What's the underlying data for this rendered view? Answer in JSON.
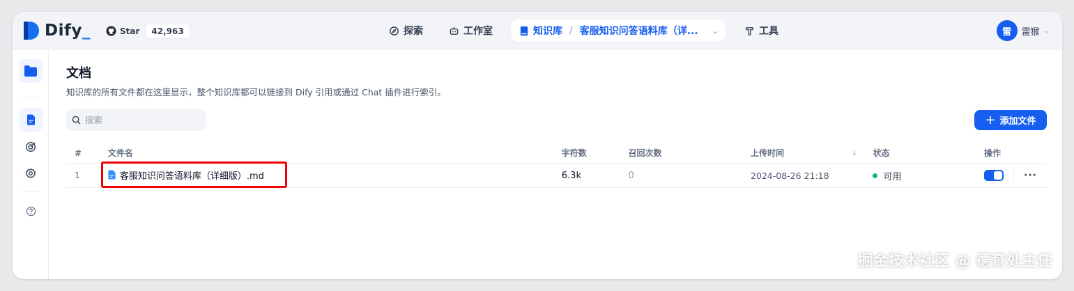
{
  "header": {
    "logo_text": "Dify",
    "logo_cursor": "_",
    "github": {
      "star_label": "Star",
      "star_count": "42,963"
    },
    "nav": {
      "explore": "探索",
      "studio": "工作室",
      "dataset": "知识库",
      "dataset_separator": "/",
      "dataset_current": "客服知识问答语料库（详...",
      "tools": "工具"
    },
    "user": {
      "avatar_initial": "雷",
      "name": "雷猴"
    }
  },
  "main": {
    "title": "文档",
    "description": "知识库的所有文件都在这里显示，整个知识库都可以链接到 Dify 引用或通过 Chat 插件进行索引。",
    "search_placeholder": "搜索",
    "add_button": "添加文件",
    "table": {
      "headers": {
        "index": "#",
        "name": "文件名",
        "chars": "字符数",
        "hits": "召回次数",
        "upload_time": "上传时间",
        "status": "状态",
        "actions": "操作"
      },
      "rows": [
        {
          "index": "1",
          "name": "客服知识问答语料库（详细版）.md",
          "chars": "6.3k",
          "hits": "0",
          "upload_time": "2024-08-26 21:18",
          "status": "可用",
          "enabled": true,
          "more": "···"
        }
      ]
    }
  },
  "watermark": "掘金技术社区 @ 德育处主任",
  "colors": {
    "accent": "#155eef",
    "status_ok": "#12b76a",
    "highlight": "#ee0000"
  }
}
